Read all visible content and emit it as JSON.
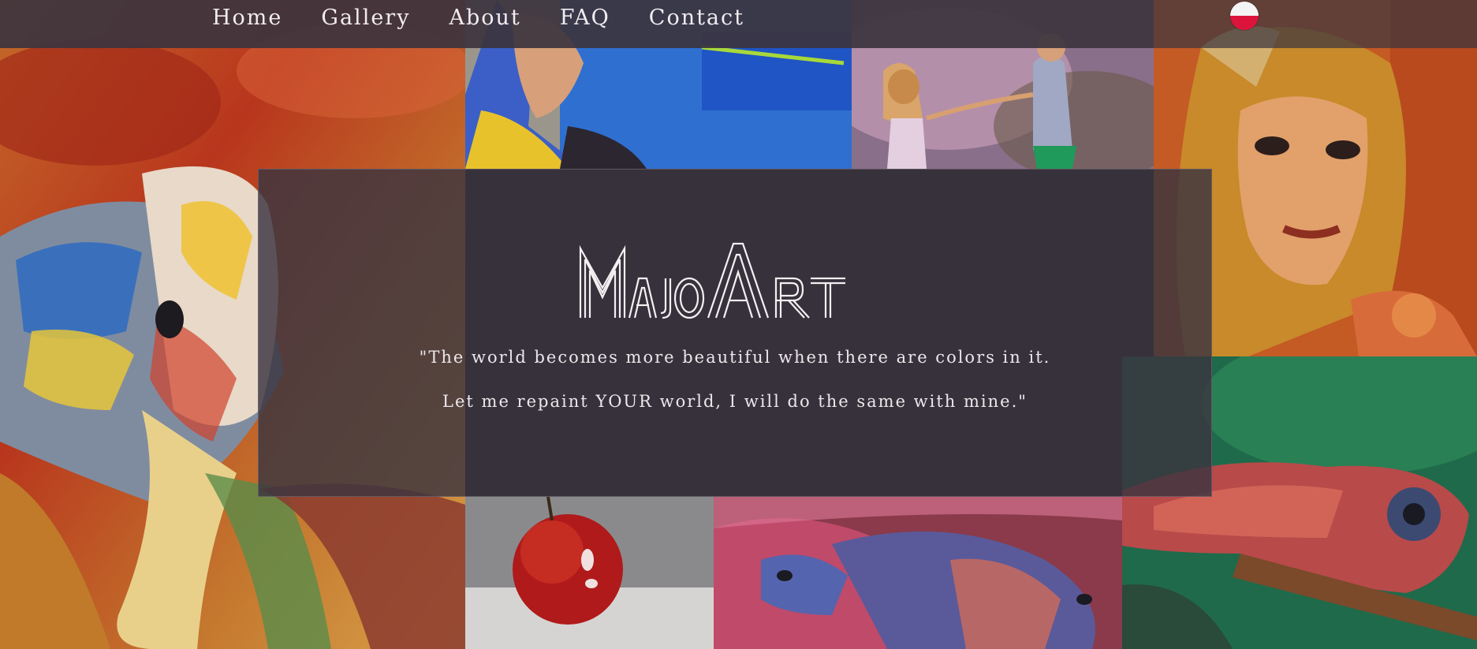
{
  "nav": {
    "items": [
      "Home",
      "Gallery",
      "About",
      "FAQ",
      "Contact"
    ]
  },
  "language": {
    "icon": "poland-flag-icon",
    "colors": {
      "top": "#f4f4f4",
      "bottom": "#dc143c"
    }
  },
  "hero": {
    "logo_text": "MajoArt",
    "quote_line1": "\"The world becomes more beautiful when there are colors in it.",
    "quote_line2": "Let me repaint YOUR world, I will do the same with mine.\""
  },
  "colors": {
    "nav_bg": "#3c343e",
    "hero_bg": "#3a3440",
    "text": "#f1ecef"
  }
}
